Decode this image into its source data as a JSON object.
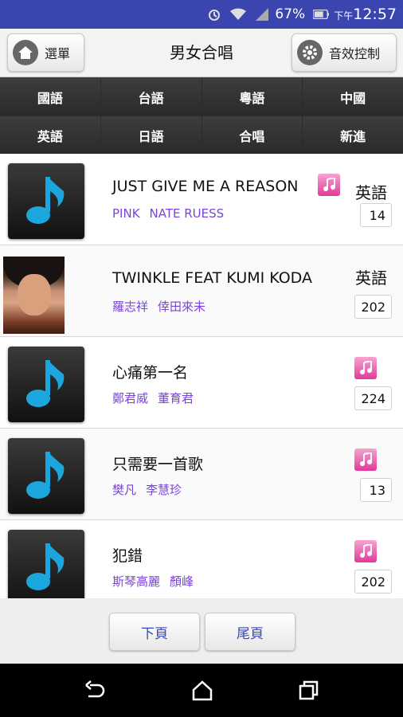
{
  "status_bar": {
    "battery_percent": "67%",
    "time_prefix": "下午",
    "time": "12:57"
  },
  "header": {
    "menu_label": "選單",
    "title": "男女合唱",
    "sound_label": "音效控制"
  },
  "categories": [
    "國語",
    "台語",
    "粵語",
    "中國",
    "英語",
    "日語",
    "合唱",
    "新進"
  ],
  "songs": [
    {
      "title": "JUST GIVE ME A REASON",
      "artists": [
        "PINK",
        "NATE RUESS"
      ],
      "language": "英語",
      "count": "14",
      "thumb": "music-note",
      "badge": true
    },
    {
      "title": "TWINKLE FEAT KUMI KODA",
      "artists": [
        "羅志祥",
        "倖田來未"
      ],
      "language": "英語",
      "count": "202",
      "thumb": "artist-photo",
      "badge": false
    },
    {
      "title": "心痛第一名",
      "artists": [
        "鄭君威",
        "董育君"
      ],
      "language": "",
      "count": "224",
      "thumb": "music-note",
      "badge": true
    },
    {
      "title": "只需要一首歌",
      "artists": [
        "樊凡",
        "李慧珍"
      ],
      "language": "",
      "count": "13",
      "thumb": "music-note",
      "badge": true
    },
    {
      "title": "犯錯",
      "artists": [
        "斯琴高麗",
        "顏峰"
      ],
      "language": "",
      "count": "202",
      "thumb": "music-note",
      "badge": true
    }
  ],
  "pager": {
    "next_label": "下頁",
    "last_label": "尾頁"
  },
  "colors": {
    "status_bar": "#3b45b0",
    "artist_text": "#7a44d8",
    "pager_text": "#3a4ab8",
    "music_note": "#1ba6dd",
    "badge": "#e03a9a"
  }
}
